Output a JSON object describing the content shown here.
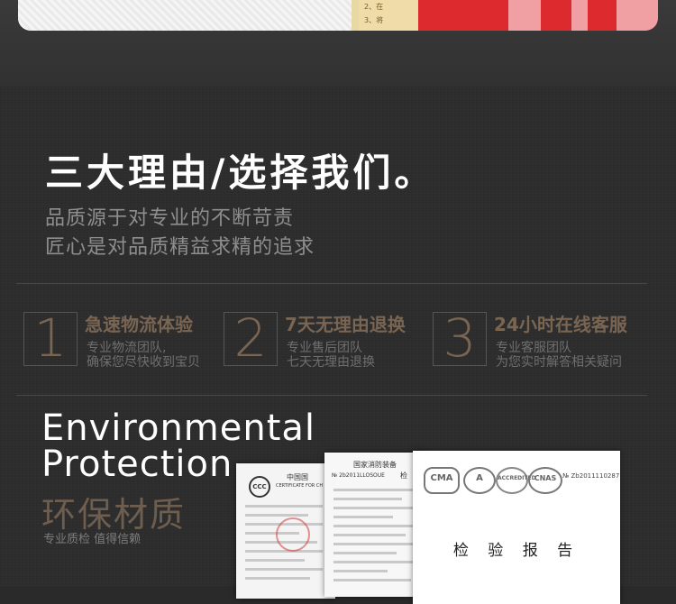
{
  "banner": {
    "paper_lines": [
      "2、在",
      "3、将"
    ]
  },
  "heading": "三大理由/选择我们。",
  "subheading": [
    "品质源于对专业的不断苛责",
    "匠心是对品质精益求精的追求"
  ],
  "reasons": [
    {
      "number": "1",
      "title": "急速物流体验",
      "lines": [
        "专业物流团队,",
        "确保您尽快收到宝贝"
      ]
    },
    {
      "number": "2",
      "title": "7天无理由退换",
      "lines": [
        "专业售后团队",
        "七天无理由退换"
      ]
    },
    {
      "number": "3",
      "title": "24小时在线客服",
      "lines": [
        "专业客服团队",
        "为您实时解答相关疑问"
      ]
    }
  ],
  "environment": {
    "title_en": [
      "Environmental",
      "Protection"
    ],
    "title_cn": "环保材质",
    "subtitle": "专业质检 值得信赖"
  },
  "certificates": {
    "c1": {
      "header": "中国国",
      "sub": "CERTIFICATE FOR CH",
      "logo": "CCC"
    },
    "c2": {
      "header": "国家消防装备",
      "code": "№ 2b2011LLOSOUE",
      "check": "检"
    },
    "c3": {
      "badges": [
        "CMA",
        "A",
        "ACCREDITED",
        "CNAS"
      ],
      "cert_no": "№ Zb2011110287",
      "title": "检 验 报 告"
    }
  },
  "colors": {
    "background": "#2d2d2d",
    "accent_brown": "#7a6552",
    "heading_white": "#ffffff",
    "muted_gray": "#8e8e8e",
    "banner_red": "#dc2a2e"
  }
}
